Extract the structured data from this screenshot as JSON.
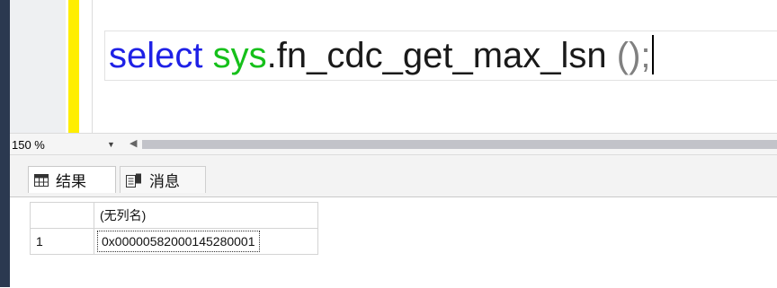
{
  "editor": {
    "tokens": [
      {
        "text": "select",
        "kind": "kw"
      },
      {
        "text": " ",
        "kind": "plain"
      },
      {
        "text": "sys",
        "kind": "sysfn"
      },
      {
        "text": ".fn_cdc_get_max_lsn",
        "kind": "plain"
      },
      {
        "text": " ();",
        "kind": "punct"
      }
    ],
    "colors": {
      "keyword": "#1f21e6",
      "system": "#16c01b",
      "punct": "#808080"
    }
  },
  "zoom": {
    "value": "150 %"
  },
  "result_tabs": [
    {
      "label": "结果",
      "icon": "grid-icon",
      "active": true
    },
    {
      "label": "消息",
      "icon": "messages-icon",
      "active": false
    }
  ],
  "grid": {
    "columns": [
      "",
      "(无列名)"
    ],
    "rows": [
      {
        "num": "1",
        "value": "0x00000582000145280001"
      }
    ]
  }
}
